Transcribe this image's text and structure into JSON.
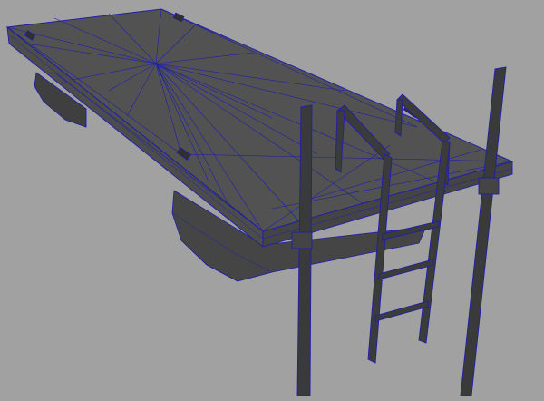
{
  "viewport": {
    "background_color": "#a1a1a1",
    "wire_color": "#1f1fa8",
    "shade_dark": "#3b3b3b",
    "shade_mid": "#4a4a4a",
    "shade_light": "#5a5a5a",
    "shade_top": "#525252"
  },
  "scene": {
    "object": "floating-dock-mesh",
    "components": [
      "dock-deck",
      "dock-side-face",
      "pontoon-front",
      "pontoon-rear",
      "ladder",
      "mooring-post-left",
      "mooring-post-right",
      "deck-cleat-front",
      "deck-cleat-mid",
      "deck-cleat-rear"
    ]
  }
}
